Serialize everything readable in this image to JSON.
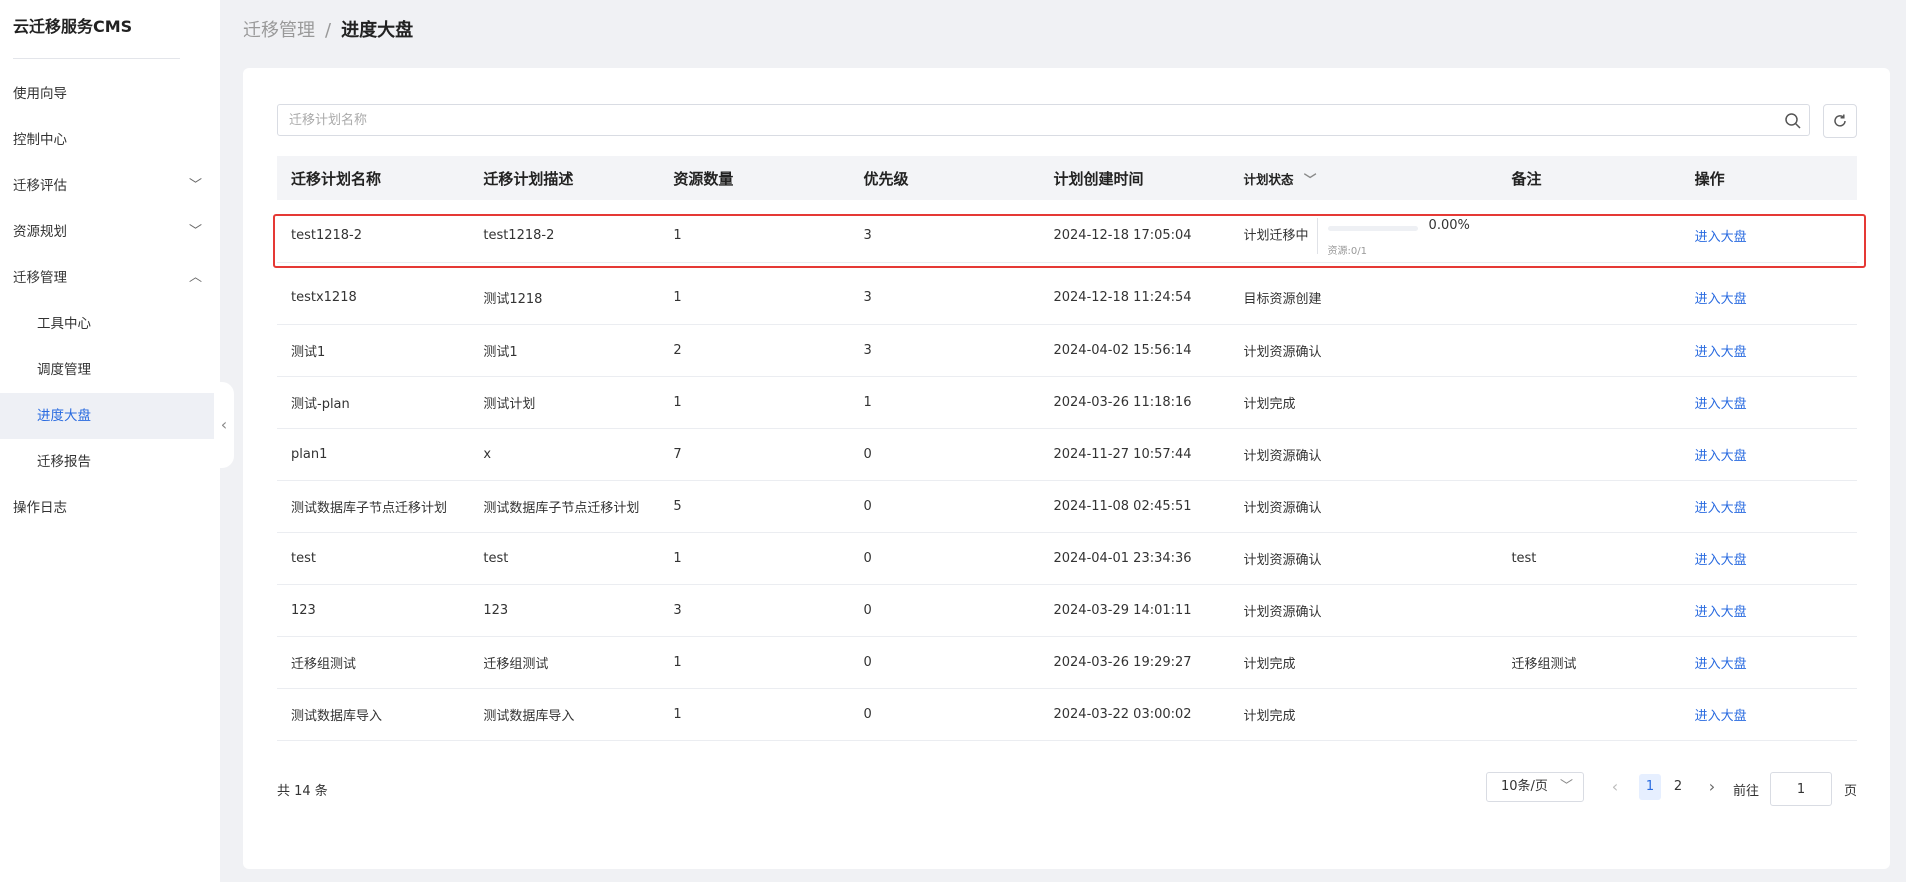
{
  "app": {
    "title": "云迁移服务CMS"
  },
  "sidebar": {
    "items": [
      {
        "label": "使用向导"
      },
      {
        "label": "控制中心"
      },
      {
        "label": "迁移评估"
      },
      {
        "label": "资源规划"
      },
      {
        "label": "迁移管理"
      },
      {
        "label": "工具中心"
      },
      {
        "label": "调度管理"
      },
      {
        "label": "进度大盘"
      },
      {
        "label": "迁移报告"
      },
      {
        "label": "操作日志"
      }
    ]
  },
  "breadcrumb": {
    "parent": "迁移管理",
    "separator": "/",
    "current": "进度大盘"
  },
  "search": {
    "placeholder": "迁移计划名称",
    "value": ""
  },
  "table": {
    "headers": [
      "迁移计划名称",
      "迁移计划描述",
      "资源数量",
      "优先级",
      "计划创建时间",
      "计划状态",
      "备注",
      "操作"
    ],
    "rows": [
      {
        "name": "test1218-2",
        "desc": "test1218-2",
        "count": "1",
        "priority": "3",
        "created": "2024-12-18 17:05:04",
        "status": "计划迁移中",
        "note": "",
        "op": "进入大盘",
        "progress": {
          "percent": "0.00%",
          "resources": "资源:0/1",
          "fraction": 0
        }
      },
      {
        "name": "testx1218",
        "desc": "测试1218",
        "count": "1",
        "priority": "3",
        "created": "2024-12-18 11:24:54",
        "status": "目标资源创建",
        "note": "",
        "op": "进入大盘"
      },
      {
        "name": "测试1",
        "desc": "测试1",
        "count": "2",
        "priority": "3",
        "created": "2024-04-02 15:56:14",
        "status": "计划资源确认",
        "note": "",
        "op": "进入大盘"
      },
      {
        "name": "测试-plan",
        "desc": "测试计划",
        "count": "1",
        "priority": "1",
        "created": "2024-03-26 11:18:16",
        "status": "计划完成",
        "note": "",
        "op": "进入大盘"
      },
      {
        "name": "plan1",
        "desc": "x",
        "count": "7",
        "priority": "0",
        "created": "2024-11-27 10:57:44",
        "status": "计划资源确认",
        "note": "",
        "op": "进入大盘"
      },
      {
        "name": "测试数据库子节点迁移计划",
        "desc": "测试数据库子节点迁移计划",
        "count": "5",
        "priority": "0",
        "created": "2024-11-08 02:45:51",
        "status": "计划资源确认",
        "note": "",
        "op": "进入大盘"
      },
      {
        "name": "test",
        "desc": "test",
        "count": "1",
        "priority": "0",
        "created": "2024-04-01 23:34:36",
        "status": "计划资源确认",
        "note": "test",
        "op": "进入大盘"
      },
      {
        "name": "123",
        "desc": "123",
        "count": "3",
        "priority": "0",
        "created": "2024-03-29 14:01:11",
        "status": "计划资源确认",
        "note": "",
        "op": "进入大盘"
      },
      {
        "name": "迁移组测试",
        "desc": "迁移组测试",
        "count": "1",
        "priority": "0",
        "created": "2024-03-26 19:29:27",
        "status": "计划完成",
        "note": "迁移组测试",
        "op": "进入大盘"
      },
      {
        "name": "测试数据库导入",
        "desc": "测试数据库导入",
        "count": "1",
        "priority": "0",
        "created": "2024-03-22 03:00:02",
        "status": "计划完成",
        "note": "",
        "op": "进入大盘"
      }
    ]
  },
  "pagination": {
    "total": "共 14 条",
    "page_size": "10条/页",
    "pages": [
      "1",
      "2"
    ],
    "current": "1",
    "goto_label": "前往",
    "goto_value": "1",
    "goto_suffix": "页"
  },
  "colors": {
    "accent": "#2a6be0",
    "highlight": "#e53935"
  },
  "icons": {
    "search": "search-icon",
    "refresh": "refresh-icon",
    "collapse": "chevron-left-icon"
  }
}
